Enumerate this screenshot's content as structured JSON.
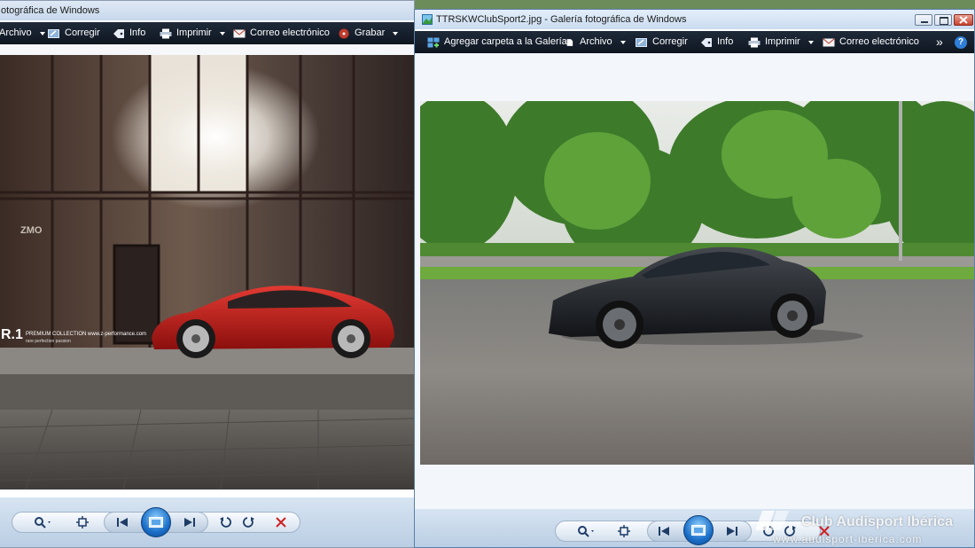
{
  "left_window": {
    "title": "otográfica de Windows",
    "toolbar": [
      {
        "label": "Archivo",
        "icon": "none",
        "dropdown": true
      },
      {
        "label": "Corregir",
        "icon": "edit-icon",
        "dropdown": false
      },
      {
        "label": "Info",
        "icon": "info-tag-icon",
        "dropdown": false
      },
      {
        "label": "Imprimir",
        "icon": "printer-icon",
        "dropdown": true
      },
      {
        "label": "Correo electrónico",
        "icon": "email-icon",
        "dropdown": false
      },
      {
        "label": "Grabar",
        "icon": "burn-disc-icon",
        "dropdown": true
      }
    ],
    "photo_text": {
      "logo": "R.1",
      "subtitle": "PREMIUM COLLECTION www.z-performance.com",
      "sub2": "rare perfection passion",
      "sign": "ZMO"
    }
  },
  "right_window": {
    "title": "TTRSKWClubSport2.jpg - Galería fotográfica de Windows",
    "toolbar": [
      {
        "label": "Agregar carpeta a la Galería",
        "icon": "add-folder-icon",
        "dropdown": false
      },
      {
        "label": "Archivo",
        "icon": "file-icon",
        "dropdown": true
      },
      {
        "label": "Corregir",
        "icon": "edit-icon",
        "dropdown": false
      },
      {
        "label": "Info",
        "icon": "info-tag-icon",
        "dropdown": false
      },
      {
        "label": "Imprimir",
        "icon": "printer-icon",
        "dropdown": true
      },
      {
        "label": "Correo electrónico",
        "icon": "email-icon",
        "dropdown": false
      }
    ],
    "overflow": "»",
    "help": "?"
  },
  "watermark": {
    "line1": "Club Audisport Ibérica",
    "line2": "www.audisport-iberica.com"
  },
  "colors": {
    "toolbar": "#15202e",
    "delete": "#d02020",
    "nav_blue": "#1b6fc8"
  }
}
